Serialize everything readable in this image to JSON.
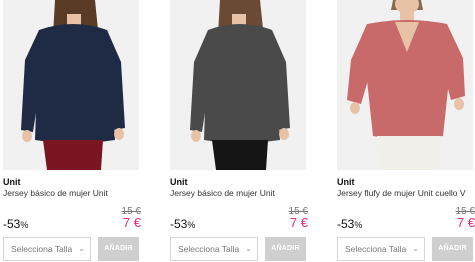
{
  "products": [
    {
      "brand": "Unit",
      "name": "Jersey básico de mujer Unit",
      "old_price": "15 €",
      "discount": "-53",
      "discount_unit": "%",
      "price": "7 €",
      "size_placeholder": "Selecciona Talla",
      "add_label": "AÑADIR",
      "garment_color": "#1f2a44",
      "pants_color": "#7a1622"
    },
    {
      "brand": "Unit",
      "name": "Jersey básico de mujer Unit",
      "old_price": "15 €",
      "discount": "-53",
      "discount_unit": "%",
      "price": "7 €",
      "size_placeholder": "Selecciona Talla",
      "add_label": "AÑADIR",
      "garment_color": "#4a4a4a",
      "pants_color": "#151515"
    },
    {
      "brand": "Unit",
      "name": "Jersey flufy de mujer Unit cuello V",
      "old_price": "15 €",
      "discount": "-53",
      "discount_unit": "%",
      "price": "7 €",
      "size_placeholder": "Selecciona Talla",
      "add_label": "AÑADIR",
      "garment_color": "#c96a6a",
      "pants_color": "#f2f0ea"
    }
  ],
  "colors": {
    "price": "#e62a7d",
    "button_bg": "#cfcfcf",
    "photo_bg": "#f1f1f1"
  },
  "icons": {
    "dropdown": "chevron-down-icon"
  }
}
